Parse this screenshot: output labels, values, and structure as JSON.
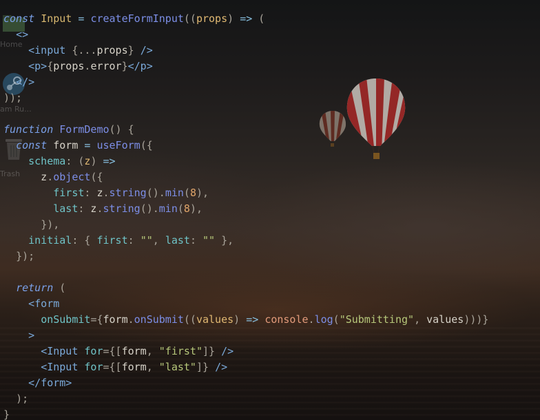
{
  "desktop": {
    "icons": [
      {
        "label": "Home",
        "icon": "home-folder-icon"
      },
      {
        "label": "am Ru...",
        "icon": "steam-icon"
      },
      {
        "label": "Trash",
        "icon": "trash-icon"
      }
    ]
  },
  "colors": {
    "keyword": "#7aa0e8",
    "function": "#7c8ee6",
    "string": "#b6c77a",
    "number": "#e0a56a",
    "tag": "#7aa9d9",
    "text": "#d6d2c8"
  },
  "code": {
    "lines": [
      [
        [
          "kw",
          "const"
        ],
        [
          "id",
          " "
        ],
        [
          "cls",
          "Input"
        ],
        [
          "id",
          " "
        ],
        [
          "op",
          "="
        ],
        [
          "id",
          " "
        ],
        [
          "fn",
          "createFormInput"
        ],
        [
          "punc",
          "(("
        ],
        [
          "param",
          "props"
        ],
        [
          "punc",
          ")"
        ],
        [
          "id",
          " "
        ],
        [
          "op",
          "=>"
        ],
        [
          "id",
          " "
        ],
        [
          "punc",
          "("
        ]
      ],
      [
        [
          "id",
          "  "
        ],
        [
          "tag",
          "<>"
        ]
      ],
      [
        [
          "id",
          "    "
        ],
        [
          "tag",
          "<input"
        ],
        [
          "id",
          " "
        ],
        [
          "punc",
          "{..."
        ],
        [
          "id",
          "props"
        ],
        [
          "punc",
          "}"
        ],
        [
          "id",
          " "
        ],
        [
          "tag",
          "/>"
        ]
      ],
      [
        [
          "id",
          "    "
        ],
        [
          "tag",
          "<p>"
        ],
        [
          "punc",
          "{"
        ],
        [
          "id",
          "props"
        ],
        [
          "punc",
          "."
        ],
        [
          "id",
          "error"
        ],
        [
          "punc",
          "}"
        ],
        [
          "tag",
          "</p>"
        ]
      ],
      [
        [
          "id",
          "  "
        ],
        [
          "tag",
          "</>"
        ]
      ],
      [
        [
          "punc",
          "));"
        ]
      ],
      [
        [
          "id",
          ""
        ]
      ],
      [
        [
          "kw",
          "function"
        ],
        [
          "id",
          " "
        ],
        [
          "fn",
          "FormDemo"
        ],
        [
          "punc",
          "()"
        ],
        [
          "id",
          " "
        ],
        [
          "punc",
          "{"
        ]
      ],
      [
        [
          "id",
          "  "
        ],
        [
          "kw",
          "const"
        ],
        [
          "id",
          " form "
        ],
        [
          "op",
          "="
        ],
        [
          "id",
          " "
        ],
        [
          "fn",
          "useForm"
        ],
        [
          "punc",
          "({"
        ]
      ],
      [
        [
          "id",
          "    "
        ],
        [
          "prop",
          "schema"
        ],
        [
          "punc",
          ":"
        ],
        [
          "id",
          " "
        ],
        [
          "punc",
          "("
        ],
        [
          "param",
          "z"
        ],
        [
          "punc",
          ")"
        ],
        [
          "id",
          " "
        ],
        [
          "op",
          "=>"
        ]
      ],
      [
        [
          "id",
          "      z"
        ],
        [
          "punc",
          "."
        ],
        [
          "fn",
          "object"
        ],
        [
          "punc",
          "({"
        ]
      ],
      [
        [
          "id",
          "        "
        ],
        [
          "prop",
          "first"
        ],
        [
          "punc",
          ":"
        ],
        [
          "id",
          " z"
        ],
        [
          "punc",
          "."
        ],
        [
          "fn",
          "string"
        ],
        [
          "punc",
          "()."
        ],
        [
          "fn",
          "min"
        ],
        [
          "punc",
          "("
        ],
        [
          "num",
          "8"
        ],
        [
          "punc",
          "),"
        ]
      ],
      [
        [
          "id",
          "        "
        ],
        [
          "prop",
          "last"
        ],
        [
          "punc",
          ":"
        ],
        [
          "id",
          " z"
        ],
        [
          "punc",
          "."
        ],
        [
          "fn",
          "string"
        ],
        [
          "punc",
          "()."
        ],
        [
          "fn",
          "min"
        ],
        [
          "punc",
          "("
        ],
        [
          "num",
          "8"
        ],
        [
          "punc",
          "),"
        ]
      ],
      [
        [
          "id",
          "      "
        ],
        [
          "punc",
          "}),"
        ]
      ],
      [
        [
          "id",
          "    "
        ],
        [
          "prop",
          "initial"
        ],
        [
          "punc",
          ":"
        ],
        [
          "id",
          " "
        ],
        [
          "punc",
          "{"
        ],
        [
          "id",
          " "
        ],
        [
          "prop",
          "first"
        ],
        [
          "punc",
          ":"
        ],
        [
          "id",
          " "
        ],
        [
          "str",
          "\"\""
        ],
        [
          "punc",
          ","
        ],
        [
          "id",
          " "
        ],
        [
          "prop",
          "last"
        ],
        [
          "punc",
          ":"
        ],
        [
          "id",
          " "
        ],
        [
          "str",
          "\"\""
        ],
        [
          "id",
          " "
        ],
        [
          "punc",
          "},"
        ]
      ],
      [
        [
          "id",
          "  "
        ],
        [
          "punc",
          "});"
        ]
      ],
      [
        [
          "id",
          ""
        ]
      ],
      [
        [
          "id",
          "  "
        ],
        [
          "kw",
          "return"
        ],
        [
          "id",
          " "
        ],
        [
          "punc",
          "("
        ]
      ],
      [
        [
          "id",
          "    "
        ],
        [
          "tag",
          "<form"
        ]
      ],
      [
        [
          "id",
          "      "
        ],
        [
          "prop",
          "onSubmit"
        ],
        [
          "punc",
          "={"
        ],
        [
          "id",
          "form"
        ],
        [
          "punc",
          "."
        ],
        [
          "fn",
          "onSubmit"
        ],
        [
          "punc",
          "(("
        ],
        [
          "param",
          "values"
        ],
        [
          "punc",
          ")"
        ],
        [
          "id",
          " "
        ],
        [
          "op",
          "=>"
        ],
        [
          "id",
          " "
        ],
        [
          "cons",
          "console"
        ],
        [
          "punc",
          "."
        ],
        [
          "fn",
          "log"
        ],
        [
          "punc",
          "("
        ],
        [
          "str",
          "\"Submitting\""
        ],
        [
          "punc",
          ","
        ],
        [
          "id",
          " values"
        ],
        [
          "punc",
          ")"
        ],
        [
          "punc",
          "))}"
        ]
      ],
      [
        [
          "id",
          "    "
        ],
        [
          "tag",
          ">"
        ]
      ],
      [
        [
          "id",
          "      "
        ],
        [
          "tag",
          "<Input"
        ],
        [
          "id",
          " "
        ],
        [
          "prop",
          "for"
        ],
        [
          "punc",
          "={["
        ],
        [
          "id",
          "form"
        ],
        [
          "punc",
          ","
        ],
        [
          "id",
          " "
        ],
        [
          "str",
          "\"first\""
        ],
        [
          "punc",
          "]}"
        ],
        [
          "id",
          " "
        ],
        [
          "tag",
          "/>"
        ]
      ],
      [
        [
          "id",
          "      "
        ],
        [
          "tag",
          "<Input"
        ],
        [
          "id",
          " "
        ],
        [
          "prop",
          "for"
        ],
        [
          "punc",
          "={["
        ],
        [
          "id",
          "form"
        ],
        [
          "punc",
          ","
        ],
        [
          "id",
          " "
        ],
        [
          "str",
          "\"last\""
        ],
        [
          "punc",
          "]}"
        ],
        [
          "id",
          " "
        ],
        [
          "tag",
          "/>"
        ]
      ],
      [
        [
          "id",
          "    "
        ],
        [
          "tag",
          "</form>"
        ]
      ],
      [
        [
          "id",
          "  "
        ],
        [
          "punc",
          ");"
        ]
      ],
      [
        [
          "punc",
          "}"
        ]
      ]
    ]
  }
}
